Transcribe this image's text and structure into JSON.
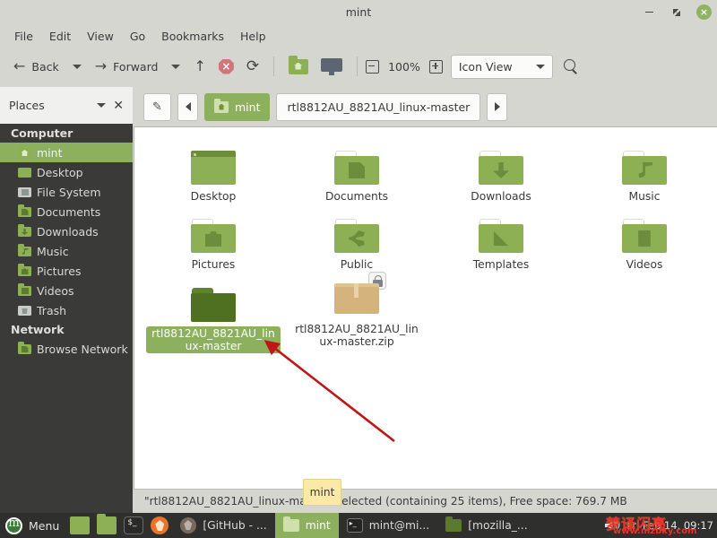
{
  "window": {
    "title": "mint",
    "controls": {
      "minimize": "–",
      "maximize": "◩",
      "close": "×"
    }
  },
  "menubar": {
    "items": [
      {
        "label": "File"
      },
      {
        "label": "Edit"
      },
      {
        "label": "View"
      },
      {
        "label": "Go"
      },
      {
        "label": "Bookmarks"
      },
      {
        "label": "Help"
      }
    ]
  },
  "toolbar": {
    "back_label": "Back",
    "forward_label": "Forward",
    "up_icon": "up-arrow-icon",
    "stop_icon": "stop-icon",
    "reload_icon": "reload-icon",
    "home_icon": "home-folder-icon",
    "computer_icon": "computer-monitor-icon",
    "zoom_out_icon": "zoom-out-icon",
    "zoom_level": "100%",
    "zoom_in_icon": "zoom-in-icon",
    "view_mode": "Icon View",
    "search_icon": "search-icon"
  },
  "pathbar": {
    "edit_icon": "pencil-icon",
    "prev_icon": "chevron-left-icon",
    "next_icon": "chevron-right-icon",
    "crumbs": [
      {
        "label": "mint",
        "active": true
      },
      {
        "label": "rtl8812AU_8821AU_linux-master",
        "active": false
      }
    ]
  },
  "sidebar": {
    "header": {
      "label": "Places",
      "dropdown_icon": "chevron-down-icon",
      "close_icon": "close-icon"
    },
    "groups": [
      {
        "label": "Computer",
        "items": [
          {
            "label": "mint",
            "icon": "home-folder-icon",
            "selected": true
          },
          {
            "label": "Desktop",
            "icon": "desktop-folder-icon",
            "selected": false
          },
          {
            "label": "File System",
            "icon": "disk-icon",
            "selected": false
          },
          {
            "label": "Documents",
            "icon": "documents-folder-icon",
            "selected": false
          },
          {
            "label": "Downloads",
            "icon": "downloads-folder-icon",
            "selected": false
          },
          {
            "label": "Music",
            "icon": "music-folder-icon",
            "selected": false
          },
          {
            "label": "Pictures",
            "icon": "pictures-folder-icon",
            "selected": false
          },
          {
            "label": "Videos",
            "icon": "videos-folder-icon",
            "selected": false
          },
          {
            "label": "Trash",
            "icon": "trash-icon",
            "selected": false
          }
        ]
      },
      {
        "label": "Network",
        "items": [
          {
            "label": "Browse Network",
            "icon": "network-folder-icon",
            "selected": false
          }
        ]
      }
    ]
  },
  "files": [
    {
      "name": "Desktop",
      "type": "desktop-folder",
      "selected": false
    },
    {
      "name": "Documents",
      "type": "folder-doc",
      "selected": false
    },
    {
      "name": "Downloads",
      "type": "folder-download",
      "selected": false
    },
    {
      "name": "Music",
      "type": "folder-music",
      "selected": false
    },
    {
      "name": "Pictures",
      "type": "folder-camera",
      "selected": false
    },
    {
      "name": "Public",
      "type": "folder-share",
      "selected": false
    },
    {
      "name": "Templates",
      "type": "folder-template",
      "selected": false
    },
    {
      "name": "Videos",
      "type": "folder-film",
      "selected": false
    },
    {
      "name": "rtl8812AU_8821AU_linux-master",
      "type": "folder-plain-dark",
      "selected": true
    },
    {
      "name": "rtl8812AU_8821AU_linux-master.zip",
      "type": "archive-locked",
      "selected": false
    }
  ],
  "statusbar": {
    "text": "\"rtl8812AU_8821AU_linux-master\" selected (containing 25 items), Free space: 769.7 MB"
  },
  "tooltip": {
    "text": "mint"
  },
  "annotation": {
    "arrow_color": "#cc1111",
    "arrow_name": "red-pointer-arrow"
  },
  "taskbar": {
    "menu_label": "Menu",
    "launchers": [
      {
        "icon": "files-launcher-icon"
      },
      {
        "icon": "folder-launcher-icon"
      },
      {
        "icon": "terminal-launcher-icon"
      },
      {
        "icon": "firefox-launcher-icon"
      }
    ],
    "tasks": [
      {
        "label": "[GitHub - ...",
        "icon": "firefox-window-icon",
        "active": false
      },
      {
        "label": "mint",
        "icon": "file-manager-icon",
        "active": true
      },
      {
        "label": "mint@mi...",
        "icon": "terminal-window-icon",
        "active": false
      },
      {
        "label": "[mozilla_...",
        "icon": "folder-window-icon",
        "active": false
      }
    ],
    "tray": {
      "volume_icon": "speaker-icon"
    },
    "clock": "Fri Feb 14, 09:17"
  },
  "watermark": {
    "text_cn": "梦译闪亮",
    "url": "www.mzbky.com"
  }
}
